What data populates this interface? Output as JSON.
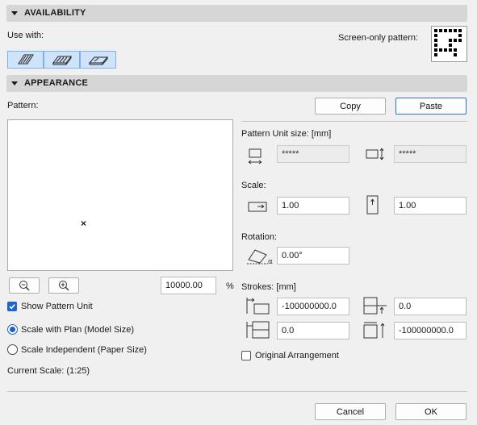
{
  "availability": {
    "header": "AVAILABILITY",
    "use_with_label": "Use with:",
    "screen_only_pattern_label": "Screen-only pattern:"
  },
  "appearance": {
    "header": "APPEARANCE",
    "pattern_label": "Pattern:",
    "copy_label": "Copy",
    "paste_label": "Paste",
    "zoom_value": "10000.00",
    "zoom_unit": "%",
    "show_pattern_unit_label": "Show Pattern Unit",
    "show_pattern_unit_checked": true,
    "scale_with_plan_label": "Scale with Plan (Model Size)",
    "scale_independent_label": "Scale Independent (Paper Size)",
    "selected_scale_mode": "scale_with_plan",
    "current_scale_label": "Current Scale: (1:25)"
  },
  "pattern_unit": {
    "label": "Pattern Unit size: [mm]",
    "width": "*****",
    "height": "*****"
  },
  "scale": {
    "label": "Scale:",
    "x": "1.00",
    "y": "1.00"
  },
  "rotation": {
    "label": "Rotation:",
    "value": "0.00°"
  },
  "strokes": {
    "label": "Strokes: [mm]",
    "left_offset": "-100000000.0",
    "top_offset": "0.0",
    "horizontal_spacing": "0.0",
    "vertical_spacing": "-100000000.0"
  },
  "original_arrangement_label": "Original Arrangement",
  "original_arrangement_checked": false,
  "footer": {
    "cancel_label": "Cancel",
    "ok_label": "OK"
  },
  "colors": {
    "accent": "#1f63c7",
    "selected_button_fill": "#cfe3fb",
    "header_fill": "#d6d6d6"
  }
}
